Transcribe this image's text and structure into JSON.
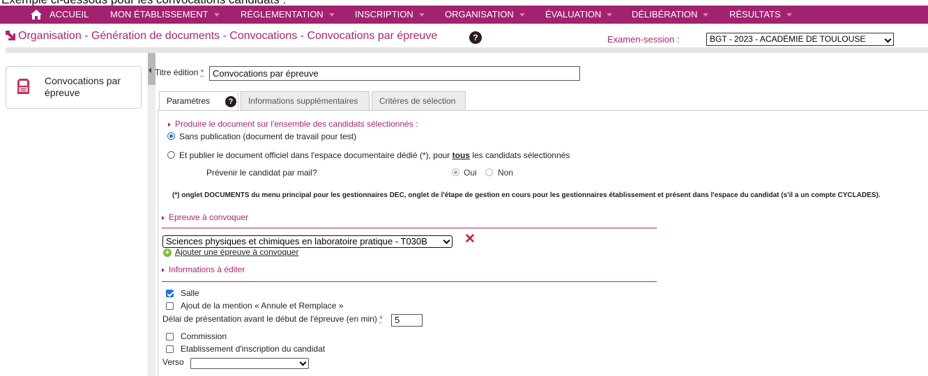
{
  "caption": "Exemple ci-dessous pour les convocations candidats :",
  "topnav": {
    "home_icon": "home-icon",
    "items": [
      {
        "label": "ACCUEIL",
        "dropdown": false
      },
      {
        "label": "MON ÉTABLISSEMENT",
        "dropdown": true
      },
      {
        "label": "RÉGLEMENTATION",
        "dropdown": true
      },
      {
        "label": "INSCRIPTION",
        "dropdown": true
      },
      {
        "label": "ORGANISATION",
        "dropdown": true
      },
      {
        "label": "ÉVALUATION",
        "dropdown": true
      },
      {
        "label": "DÉLIBÉRATION",
        "dropdown": true
      },
      {
        "label": "RÉSULTATS",
        "dropdown": true
      }
    ],
    "bg_color": "#a3226f"
  },
  "breadcrumb": {
    "text": "Organisation - Génération de documents - Convocations - Convocations par épreuve",
    "help": "?",
    "accent_color": "#b0256f"
  },
  "exam_session": {
    "label": "Examen-session :",
    "value": "BGT - 2023 - ACADÉMIE DE TOULOUSE"
  },
  "sidebar": {
    "card_label": "Convocations par épreuve",
    "icon": "document-print-icon"
  },
  "form": {
    "title_label": "Titre édition",
    "required_mark": "*",
    "title_value": "Convocations par épreuve",
    "tabs": [
      {
        "label": "Paramètres",
        "active": true
      },
      {
        "label": "Informations supplémentaires",
        "active": false
      },
      {
        "label": "Critères de sélection",
        "active": false
      }
    ],
    "tab_help": "?",
    "produire": {
      "heading": "Produire le document sur l'ensemble des candidats sélectionnés :",
      "option_sans": "Sans publication (document de travail pour test)",
      "option_publier_pre": "Et publier le document officiel dans l'espace documentaire dédié (*), pour",
      "option_publier_bold": "tous",
      "option_publier_post": "les candidats sélectionnés",
      "prevenir_label": "Prévenir le candidat par mail?",
      "oui": "Oui",
      "non": "Non",
      "selected": "sans"
    },
    "note": "(*) onglet DOCUMENTS du menu principal pour les gestionnaires DEC, onglet de l'étape de gestion en cours pour les gestionnaires établissement et présent dans l'espace du candidat (s'il a un compte CYCLADES).",
    "epreuve": {
      "heading": "Epreuve à convoquer",
      "selected": "Sciences physiques et chimiques en laboratoire pratique - T030B",
      "delete": "✕",
      "add_label": "Ajouter une épreuve à convoquer",
      "add_icon": "+"
    },
    "infos": {
      "heading": "Informations à éditer",
      "salle": {
        "label": "Salle",
        "checked": true
      },
      "annule": {
        "label": "Ajout de la mention « Annule et Remplace »",
        "checked": false
      },
      "delai_label": "Délai de présentation avant le début de l'épreuve (en min)",
      "delai_value": "5",
      "commission": {
        "label": "Commission",
        "checked": false
      },
      "etablissement": {
        "label": "Etablissement d'inscription du candidat",
        "checked": false
      },
      "verso_label": "Verso",
      "verso_value": ""
    }
  }
}
